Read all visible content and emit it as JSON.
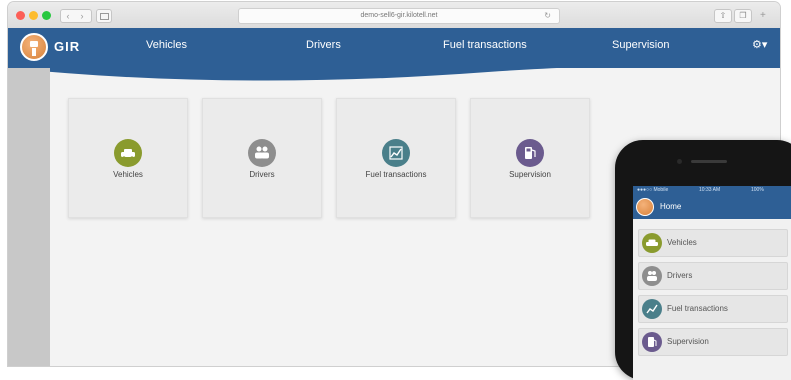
{
  "browser": {
    "url": "demo-sell6-gir.kilotell.net",
    "buttons": {
      "back": "‹",
      "forward": "›"
    }
  },
  "app": {
    "logo_text": "GIR",
    "nav": [
      "Vehicles",
      "Drivers",
      "Fuel transactions",
      "Supervision"
    ],
    "settings_label": "⚙▾"
  },
  "tiles": [
    {
      "label": "Vehicles",
      "icon": "car-icon",
      "color": "#8a9b2e"
    },
    {
      "label": "Drivers",
      "icon": "people-icon",
      "color": "#8e8e8e"
    },
    {
      "label": "Fuel transactions",
      "icon": "chart-icon",
      "color": "#4a7f8a"
    },
    {
      "label": "Supervision",
      "icon": "fuel-pump-icon",
      "color": "#6b5b8e"
    }
  ],
  "phone": {
    "status": {
      "carrier": "●●●○○ Mobile",
      "time": "10:33 AM",
      "battery": "100%"
    },
    "title": "Home",
    "items": [
      {
        "label": "Vehicles",
        "icon": "car-icon",
        "color": "#8a9b2e"
      },
      {
        "label": "Drivers",
        "icon": "people-icon",
        "color": "#8e8e8e"
      },
      {
        "label": "Fuel transactions",
        "icon": "chart-icon",
        "color": "#4a7f8a"
      },
      {
        "label": "Supervision",
        "icon": "fuel-pump-icon",
        "color": "#6b5b8e"
      }
    ]
  },
  "colors": {
    "header": "#2e5f95",
    "logo": "#d8823a"
  }
}
